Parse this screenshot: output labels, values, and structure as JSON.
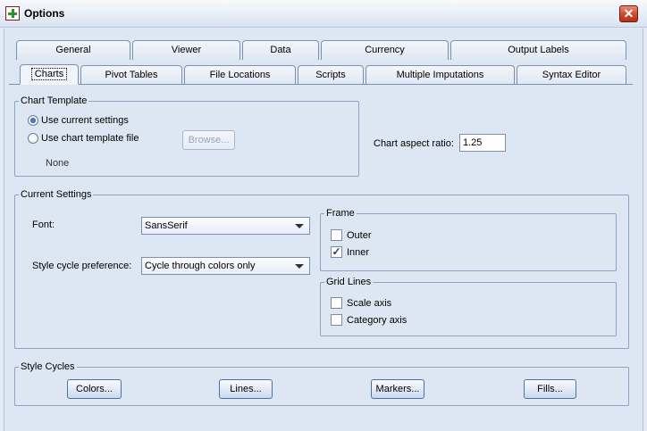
{
  "window": {
    "title": "Options",
    "close_label": "✕"
  },
  "tabs_row1": [
    "General",
    "Viewer",
    "Data",
    "Currency",
    "Output Labels"
  ],
  "tabs_row2": [
    "Charts",
    "Pivot Tables",
    "File Locations",
    "Scripts",
    "Multiple Imputations",
    "Syntax Editor"
  ],
  "chart_template": {
    "legend": "Chart Template",
    "use_current_label": "Use current settings",
    "use_file_label": "Use chart template file",
    "browse_label": "Browse...",
    "file_value": "None",
    "selected": "use_current"
  },
  "aspect": {
    "label": "Chart aspect ratio:",
    "value": "1.25"
  },
  "current_settings": {
    "legend": "Current Settings",
    "font_label": "Font:",
    "font_value": "SansSerif",
    "style_label": "Style cycle preference:",
    "style_value": "Cycle through colors only"
  },
  "frame": {
    "legend": "Frame",
    "outer_label": "Outer",
    "outer_checked": false,
    "inner_label": "Inner",
    "inner_checked": true
  },
  "grid_lines": {
    "legend": "Grid Lines",
    "scale_label": "Scale axis",
    "scale_checked": false,
    "category_label": "Category axis",
    "category_checked": false
  },
  "style_cycles": {
    "legend": "Style Cycles",
    "colors_label": "Colors...",
    "lines_label": "Lines...",
    "markers_label": "Markers...",
    "fills_label": "Fills..."
  },
  "colors": {
    "titlebar_close": "#cf4a2e",
    "tab_border": "#7f8fae",
    "panel_bg": "#dde6f3"
  }
}
